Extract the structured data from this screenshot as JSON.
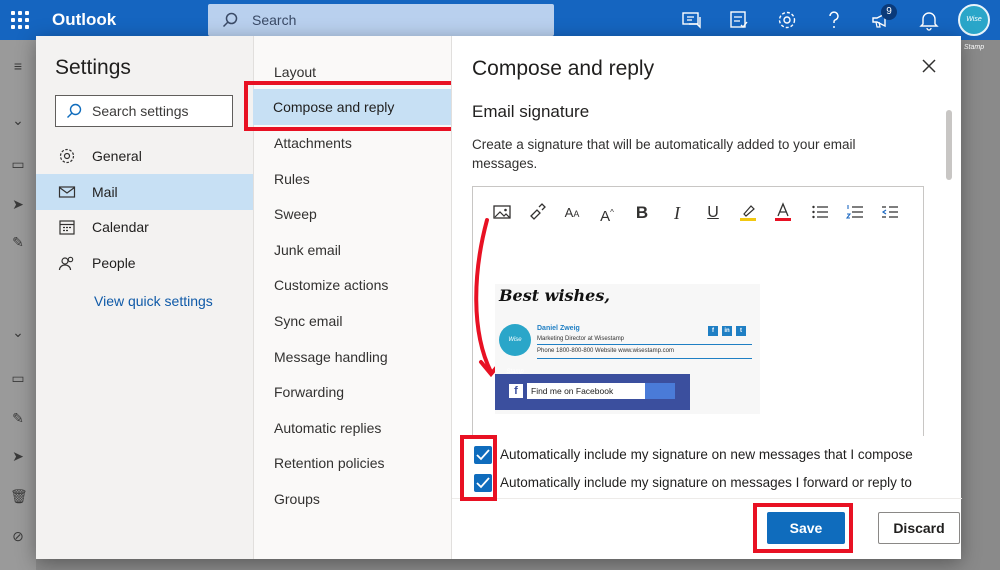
{
  "app": {
    "brand": "Outlook",
    "search_placeholder": "Search",
    "notification_count": "9",
    "avatar_text": "Wise Stamp"
  },
  "settings": {
    "title": "Settings",
    "search_placeholder": "Search settings",
    "nav": [
      {
        "label": "General",
        "icon": "gear-icon"
      },
      {
        "label": "Mail",
        "icon": "mail-icon",
        "selected": true
      },
      {
        "label": "Calendar",
        "icon": "calendar-icon"
      },
      {
        "label": "People",
        "icon": "people-icon"
      }
    ],
    "quick_link": "View quick settings"
  },
  "mail_menu": {
    "items": [
      "Layout",
      "Compose and reply",
      "Attachments",
      "Rules",
      "Sweep",
      "Junk email",
      "Customize actions",
      "Sync email",
      "Message handling",
      "Forwarding",
      "Automatic replies",
      "Retention policies",
      "Groups"
    ],
    "selected": "Compose and reply"
  },
  "pane": {
    "title": "Compose and reply",
    "section_title": "Email signature",
    "description": "Create a signature that will be automatically added to your email messages.",
    "toolbar_icons": [
      "insert-image-icon",
      "format-painter-icon",
      "font-size-icon",
      "grow-font-icon",
      "bold-icon",
      "italic-icon",
      "underline-icon",
      "highlight-icon",
      "font-color-icon",
      "bullets-icon",
      "numbering-icon",
      "decrease-indent-icon"
    ],
    "signature": {
      "closing": "Best wishes,",
      "logo_text": "Wise Stamp",
      "name": "Daniel Zweig",
      "role": "Marketing Director at Wisestamp",
      "phone_line": "Phone  1800-800-800  Website  www.wisestamp.com",
      "facebook_text": "Find me on Facebook"
    },
    "checkboxes": [
      {
        "label": "Automatically include my signature on new messages that I compose",
        "checked": true
      },
      {
        "label": "Automatically include my signature on messages I forward or reply to",
        "checked": true
      }
    ],
    "save_label": "Save",
    "discard_label": "Discard"
  },
  "colors": {
    "accent": "#0f6cbd",
    "topbar": "#1565c0",
    "selection": "#c7e0f4",
    "highlight_box": "#e81123"
  }
}
